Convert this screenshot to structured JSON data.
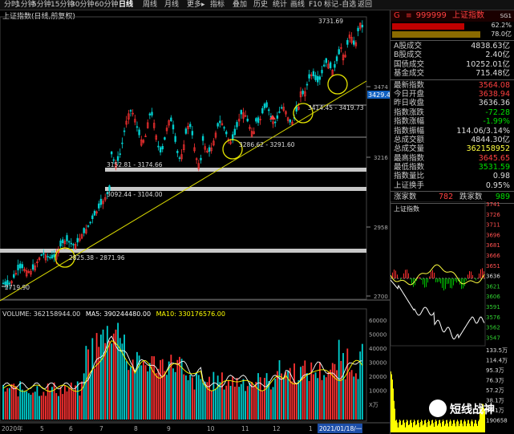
{
  "toolbar": {
    "items": [
      "分时",
      "1分钟",
      "5分钟",
      "15分钟",
      "30分钟",
      "60分钟",
      "日线",
      "周线",
      "月线",
      "更多▸",
      "指标",
      "叠加",
      "历史",
      "统计",
      "画线",
      "F10",
      "标记",
      "-自选",
      "返回"
    ],
    "active_index": 6
  },
  "main_chart": {
    "title": "上证指数(日线,前复权)",
    "price_axis": [
      "3474",
      "3216",
      "2958",
      "2700"
    ],
    "current_price_tag": "3429.4",
    "annotations": [
      "3731.69",
      "3414.45 - 3419.73",
      "3286.62 - 3291.60",
      "3152.81 - 3174.66",
      "3092.44 - 3104.00",
      "2825.38 - 2871.96",
      "2719.90"
    ],
    "volume_title": {
      "vol": "VOLUME: 362158944.00",
      "ma5": "MA5: 390244480.00",
      "ma10": "MA10: 330176576.00"
    },
    "volume_axis": [
      "60000",
      "50000",
      "40000",
      "30000",
      "20000",
      "10000",
      "X万"
    ],
    "date_axis": [
      "2020年",
      "5",
      "6",
      "7",
      "8",
      "9",
      "10",
      "11",
      "12",
      "1",
      "2021/01/18/一"
    ]
  },
  "colors": {
    "up": "#ff3232",
    "down": "#00d0d0",
    "ma5": "#ffffff",
    "ma10": "#ffff00",
    "line": "#d8d800",
    "hband": "#c8c8c8",
    "yellow_circle": "#e6e600"
  },
  "quote": {
    "header": {
      "letter": "G",
      "code": "999999",
      "name": "上证指数",
      "tag": "SG1"
    },
    "ratio_top": "62.2%",
    "ratio_bottom": "78.0亿",
    "rows1": [
      {
        "label": "A股成交",
        "value": "4838.63亿",
        "color": "#ddd"
      },
      {
        "label": "B股成交",
        "value": "2.40亿",
        "color": "#ddd"
      },
      {
        "label": "国债成交",
        "value": "10252.01亿",
        "color": "#ddd"
      },
      {
        "label": "基金成交",
        "value": "715.48亿",
        "color": "#ddd"
      }
    ],
    "rows2": [
      {
        "label": "最新指数",
        "value": "3564.08",
        "color": "#ff4040"
      },
      {
        "label": "今日开盘",
        "value": "3638.94",
        "color": "#ff4040"
      },
      {
        "label": "昨日收盘",
        "value": "3636.36",
        "color": "#ddd"
      },
      {
        "label": "指数涨跌",
        "value": "-72.28",
        "color": "#00e000"
      },
      {
        "label": "指数涨幅",
        "value": "-1.99%",
        "color": "#00e000"
      },
      {
        "label": "指数振幅",
        "value": "114.06/3.14%",
        "color": "#ddd"
      },
      {
        "label": "总成交额",
        "value": "4844.30亿",
        "color": "#ddd"
      },
      {
        "label": "总成交量",
        "value": "362158952",
        "color": "#ffff40"
      },
      {
        "label": "最高指数",
        "value": "3645.65",
        "color": "#ff4040"
      },
      {
        "label": "最低指数",
        "value": "3531.59",
        "color": "#00e000"
      },
      {
        "label": "指数量比",
        "value": "0.98",
        "color": "#ddd"
      },
      {
        "label": "上证换手",
        "value": "0.95%",
        "color": "#ddd"
      }
    ],
    "updown": {
      "up_label": "涨家数",
      "up": "782",
      "down_label": "跌家数",
      "down": "989"
    },
    "mini_title": "上证指数",
    "mini_axis": [
      "3741",
      "3726",
      "3711",
      "3696",
      "3681",
      "3666",
      "3651",
      "3636",
      "3621",
      "3606",
      "3591",
      "3576",
      "3562",
      "3547"
    ],
    "vol_axis": [
      "133.5万",
      "114.4万",
      "95.3万",
      "76.3万",
      "57.2万",
      "38.1万",
      "19.1万",
      "190658"
    ]
  },
  "watermark": "短线战神"
}
